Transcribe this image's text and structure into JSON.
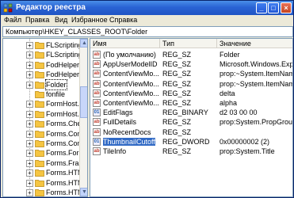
{
  "window": {
    "title": "Редактор реестра"
  },
  "titlebar_buttons": {
    "minimize": "_",
    "maximize": "□",
    "close": "×"
  },
  "menu": [
    "Файл",
    "Правка",
    "Вид",
    "Избранное",
    "Справка"
  ],
  "address": "Компьютер\\HKEY_CLASSES_ROOT\\Folder",
  "tree": {
    "items": [
      {
        "label": "FLScripting",
        "expander": "+"
      },
      {
        "label": "FLScripting",
        "expander": "+"
      },
      {
        "label": "FodHelper.",
        "expander": "+"
      },
      {
        "label": "FodHelper.",
        "expander": "+"
      },
      {
        "label": "Folder",
        "expander": "+",
        "selected": true
      },
      {
        "label": "fonfile",
        "expander": ""
      },
      {
        "label": "FormHost.F",
        "expander": "+"
      },
      {
        "label": "FormHost.F",
        "expander": "+"
      },
      {
        "label": "Forms.Chec",
        "expander": "+"
      },
      {
        "label": "Forms.Com",
        "expander": "+"
      },
      {
        "label": "Forms.Com",
        "expander": "+"
      },
      {
        "label": "Forms.Form",
        "expander": "+"
      },
      {
        "label": "Forms.Fram",
        "expander": "+"
      },
      {
        "label": "Forms.HTM",
        "expander": "+"
      },
      {
        "label": "Forms.HTM",
        "expander": "+"
      },
      {
        "label": "Forms.HTM",
        "expander": "+"
      }
    ]
  },
  "list": {
    "columns": [
      "Имя",
      "Тип",
      "Значение"
    ],
    "rows": [
      {
        "name": "(По умолчанию)",
        "type": "REG_SZ",
        "value": "Folder",
        "icon": "ab"
      },
      {
        "name": "AppUserModelID",
        "type": "REG_SZ",
        "value": "Microsoft.Windows.Exp",
        "icon": "ab"
      },
      {
        "name": "ContentViewMo...",
        "type": "REG_SZ",
        "value": "prop:~System.ItemNam",
        "icon": "ab"
      },
      {
        "name": "ContentViewMo...",
        "type": "REG_SZ",
        "value": "prop:~System.ItemNam",
        "icon": "ab"
      },
      {
        "name": "ContentViewMo...",
        "type": "REG_SZ",
        "value": "delta",
        "icon": "ab"
      },
      {
        "name": "ContentViewMo...",
        "type": "REG_SZ",
        "value": "alpha",
        "icon": "ab"
      },
      {
        "name": "EditFlags",
        "type": "REG_BINARY",
        "value": "d2 03 00 00",
        "icon": "bin"
      },
      {
        "name": "FullDetails",
        "type": "REG_SZ",
        "value": "prop:System.PropGroup",
        "icon": "ab"
      },
      {
        "name": "NoRecentDocs",
        "type": "REG_SZ",
        "value": "",
        "icon": "ab"
      },
      {
        "name": "ThumbnailCutoff",
        "type": "REG_DWORD",
        "value": "0x00000002 (2)",
        "icon": "bin",
        "selected": true
      },
      {
        "name": "TileInfo",
        "type": "REG_SZ",
        "value": "prop:System.Title",
        "icon": "ab"
      }
    ]
  },
  "icons": {
    "app": "registry-editor-icon",
    "folder": "folder-icon",
    "string_value": "string-value-icon",
    "binary_value": "binary-value-icon"
  },
  "colors": {
    "titlebar": "#2a63d4",
    "selection": "#316ac5",
    "folder": "#f5c542"
  }
}
